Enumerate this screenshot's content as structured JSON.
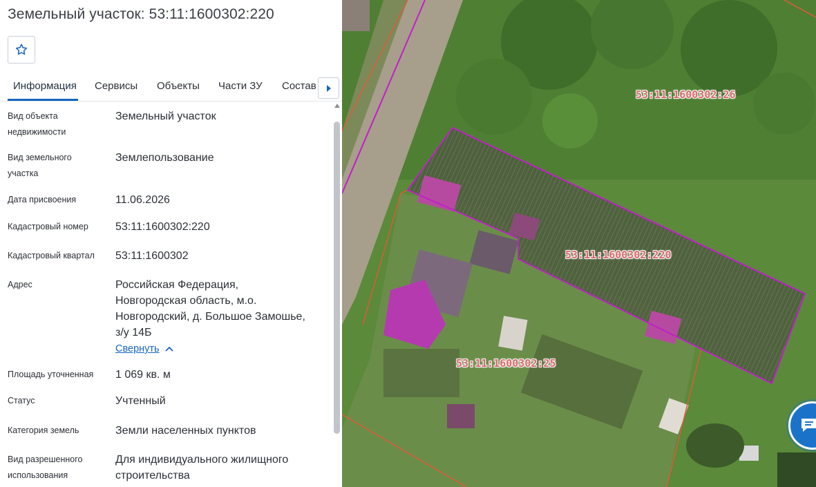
{
  "title": "Земельный участок: 53:11:1600302:220",
  "tabs": [
    {
      "label": "Информация"
    },
    {
      "label": "Сервисы"
    },
    {
      "label": "Объекты"
    },
    {
      "label": "Части ЗУ"
    },
    {
      "label": "Состав"
    }
  ],
  "icons": {
    "favorite": "star-outline-icon",
    "tab_scroll": "chevron-right-icon",
    "collapse": "chevron-up-icon",
    "chat": "chat-bubble-icon"
  },
  "colors": {
    "accent": "#1565c0",
    "parcel_selected": "#c020c8",
    "parcel_other": "#e05a3a",
    "chat": "#1a73c9"
  },
  "info": {
    "object_type": {
      "label": "Вид объекта недвижимости",
      "value": "Земельный участок"
    },
    "parcel_type": {
      "label": "Вид земельного участка",
      "value": "Землепользование"
    },
    "assign_date": {
      "label": "Дата присвоения",
      "value": "11.06.2026"
    },
    "cadastral_number": {
      "label": "Кадастровый номер",
      "value": "53:11:1600302:220"
    },
    "cadastral_block": {
      "label": "Кадастровый квартал",
      "value": "53:11:1600302"
    },
    "address": {
      "label": "Адрес",
      "line1": "Российская Федерация,",
      "line2": "Новгородская область, м.о.",
      "line3": "Новгородский, д. Большое Замошье,",
      "line4": "з/у 14Б",
      "collapse_label": "Свернуть"
    },
    "area": {
      "label": "Площадь уточненная",
      "value": "1 069 кв. м"
    },
    "status": {
      "label": "Статус",
      "value": "Учтенный"
    },
    "land_category": {
      "label": "Категория земель",
      "value": "Земли населенных пунктов"
    },
    "permitted_use": {
      "label": "Вид разрешенного использования",
      "value": "Для индивидуального жилищного строительства"
    }
  },
  "map": {
    "parcel_labels": [
      {
        "text": "53:11:1600302:26"
      },
      {
        "text": "53:11:1600302:220"
      },
      {
        "text": "53:11:1600302:25"
      }
    ]
  }
}
